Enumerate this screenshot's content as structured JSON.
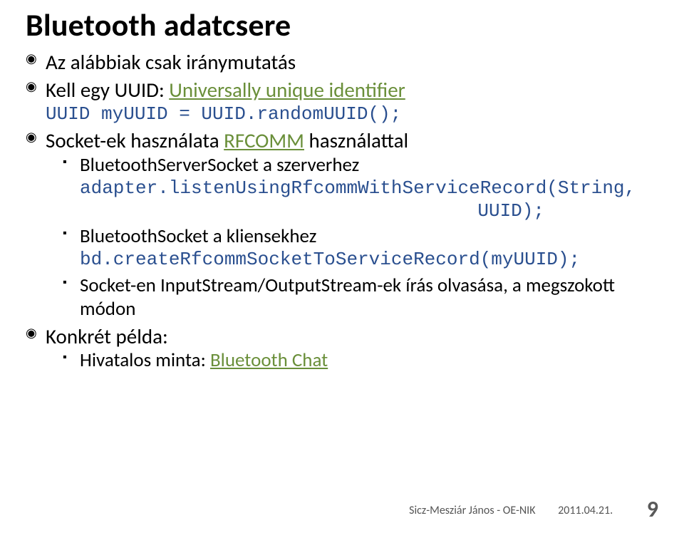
{
  "title": "Bluetooth adatcsere",
  "b1": {
    "text_a": "Az alábbiak csak iránymutatás"
  },
  "b2": {
    "prefix": "Kell egy UUID: ",
    "link": "Universally unique identifier",
    "code": "UUID myUUID = UUID.randomUUID();"
  },
  "b3": {
    "prefix": "Socket-ek használata ",
    "link": "RFCOMM",
    "suffix": " használattal",
    "sub1_text": "BluetoothServerSocket a szerverhez",
    "sub1_code_a": "adapter.listenUsingRfcommWithServiceRecord(String,",
    "sub1_code_b": "UUID);",
    "sub2_text": "BluetoothSocket a kliensekhez",
    "sub2_code": "bd.createRfcommSocketToServiceRecord(myUUID);",
    "sub3_text": "Socket-en InputStream/OutputStream-ek írás olvasása, a megszokott módon"
  },
  "b4": {
    "text": "Konkrét példa:",
    "sub1_prefix": "Hivatalos minta: ",
    "sub1_link": "Bluetooth Chat"
  },
  "footer": {
    "author": "Sicz-Mesziár János - OE-NIK",
    "date": "2011.04.21.",
    "page": "9"
  }
}
